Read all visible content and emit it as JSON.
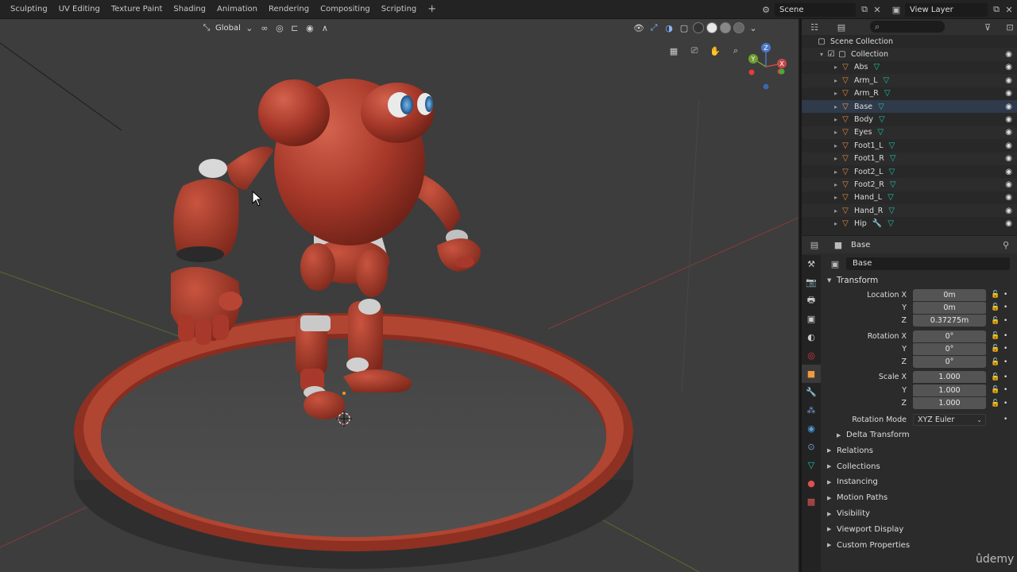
{
  "topbar": {
    "workspace_tabs": [
      "Sculpting",
      "UV Editing",
      "Texture Paint",
      "Shading",
      "Animation",
      "Rendering",
      "Compositing",
      "Scripting"
    ],
    "add_tab": "+",
    "scene_name": "Scene",
    "view_layer_name": "View Layer"
  },
  "viewport": {
    "orientation": "Global",
    "gizmo_axes": {
      "z": "Z",
      "y": "Y",
      "x": "X"
    }
  },
  "outliner": {
    "scene_collection": "Scene Collection",
    "collection": "Collection",
    "objects": [
      {
        "name": "Abs"
      },
      {
        "name": "Arm_L"
      },
      {
        "name": "Arm_R"
      },
      {
        "name": "Base"
      },
      {
        "name": "Body"
      },
      {
        "name": "Eyes"
      },
      {
        "name": "Foot1_L"
      },
      {
        "name": "Foot1_R"
      },
      {
        "name": "Foot2_L"
      },
      {
        "name": "Foot2_R"
      },
      {
        "name": "Hand_L"
      },
      {
        "name": "Hand_R"
      },
      {
        "name": "Hip",
        "has_modifier": true
      }
    ]
  },
  "properties": {
    "header_object": "Base",
    "object_name": "Base",
    "transform_title": "Transform",
    "location": {
      "label": "Location X",
      "x": "0m",
      "y": "0m",
      "z": "0.37275m"
    },
    "rotation": {
      "label": "Rotation X",
      "x": "0°",
      "y": "0°",
      "z": "0°"
    },
    "scale": {
      "label": "Scale X",
      "x": "1.000",
      "y": "1.000",
      "z": "1.000"
    },
    "axis_labels": {
      "y": "Y",
      "z": "Z"
    },
    "rotation_mode_label": "Rotation Mode",
    "rotation_mode_value": "XYZ Euler",
    "delta_transform": "Delta Transform",
    "panels": [
      "Relations",
      "Collections",
      "Instancing",
      "Motion Paths",
      "Visibility",
      "Viewport Display",
      "Custom Properties"
    ]
  },
  "watermark": "ûdemy",
  "colors": {
    "robot_red": "#a8392a",
    "viewport_bg": "#3d3d3d",
    "mesh_icon": "#18c3a6",
    "object_icon": "#e08a3c",
    "accent_blue": "#4772b3"
  }
}
